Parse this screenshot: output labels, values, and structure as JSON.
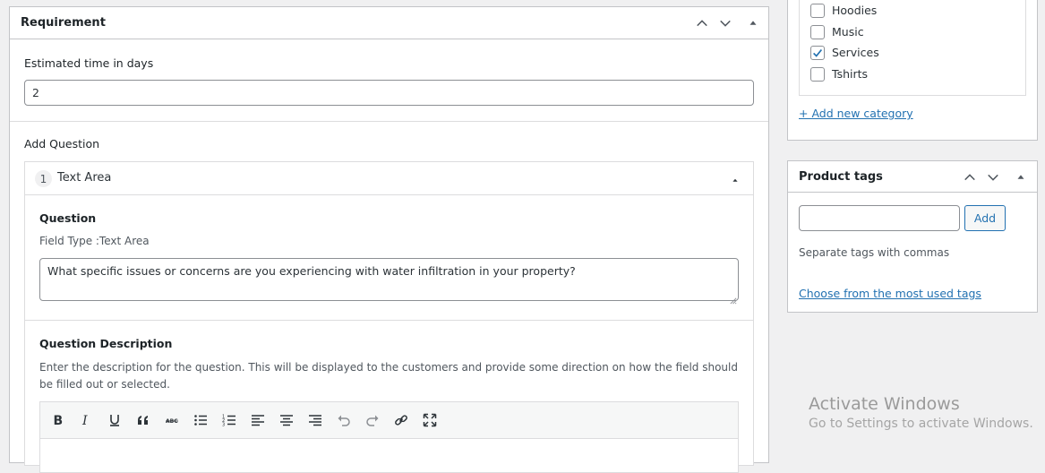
{
  "requirement": {
    "title": "Requirement",
    "estimated_label": "Estimated time in days",
    "estimated_value": "2",
    "add_question_label": "Add Question",
    "question_item": {
      "number": "1",
      "type": "Text Area",
      "question_label": "Question",
      "field_type": "Field Type :Text Area",
      "question_value": "What specific issues or concerns are you experiencing with water infiltration in your property?",
      "description_label": "Question Description",
      "description_help": "Enter the description for the question. This will be displayed to the customers and provide some direction on how the field should be filled out or selected."
    }
  },
  "categories": {
    "items": [
      {
        "label": "Hoodies",
        "checked": false
      },
      {
        "label": "Music",
        "checked": false
      },
      {
        "label": "Services",
        "checked": true
      },
      {
        "label": "Tshirts",
        "checked": false
      }
    ],
    "add_new": "+ Add new category"
  },
  "tags": {
    "title": "Product tags",
    "input_value": "",
    "add_button": "Add",
    "help": "Separate tags with commas",
    "choose_link": "Choose from the most used tags"
  },
  "watermark": {
    "line1": "Activate Windows",
    "line2": "Go to Settings to activate Windows."
  }
}
